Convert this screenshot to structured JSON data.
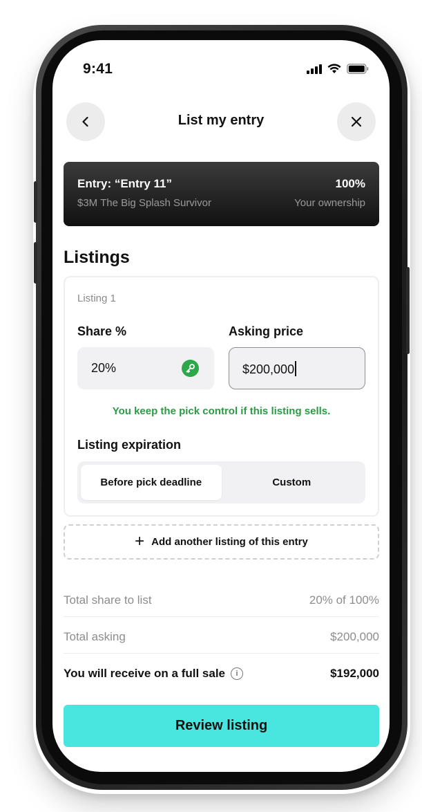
{
  "status_bar": {
    "time": "9:41"
  },
  "header": {
    "title": "List my entry",
    "back_icon": "chevron-left-icon",
    "close_icon": "close-icon"
  },
  "entry": {
    "title": "Entry: “Entry 11”",
    "subtitle": "$3M The Big Splash Survivor",
    "ownership_value": "100%",
    "ownership_label": "Your ownership"
  },
  "listings": {
    "section_title": "Listings",
    "items": [
      {
        "label": "Listing 1",
        "share_label": "Share %",
        "share_value": "20%",
        "price_label": "Asking price",
        "price_value": "$200,000",
        "note": "You keep the pick control if this listing sells.",
        "expiration_label": "Listing expiration",
        "expiration_options": [
          "Before pick deadline",
          "Custom"
        ],
        "expiration_selected": "Before pick deadline"
      }
    ],
    "add_label": "Add another listing of this entry"
  },
  "summary": {
    "total_share_label": "Total share to list",
    "total_share_value": "20% of 100%",
    "total_asking_label": "Total asking",
    "total_asking_value": "$200,000",
    "receive_label": "You will receive on a full sale",
    "receive_value": "$192,000"
  },
  "cta": {
    "label": "Review listing"
  },
  "colors": {
    "accent": "#49E5DF",
    "success": "#2B9A45",
    "card_dark": "#1A1A1A"
  }
}
